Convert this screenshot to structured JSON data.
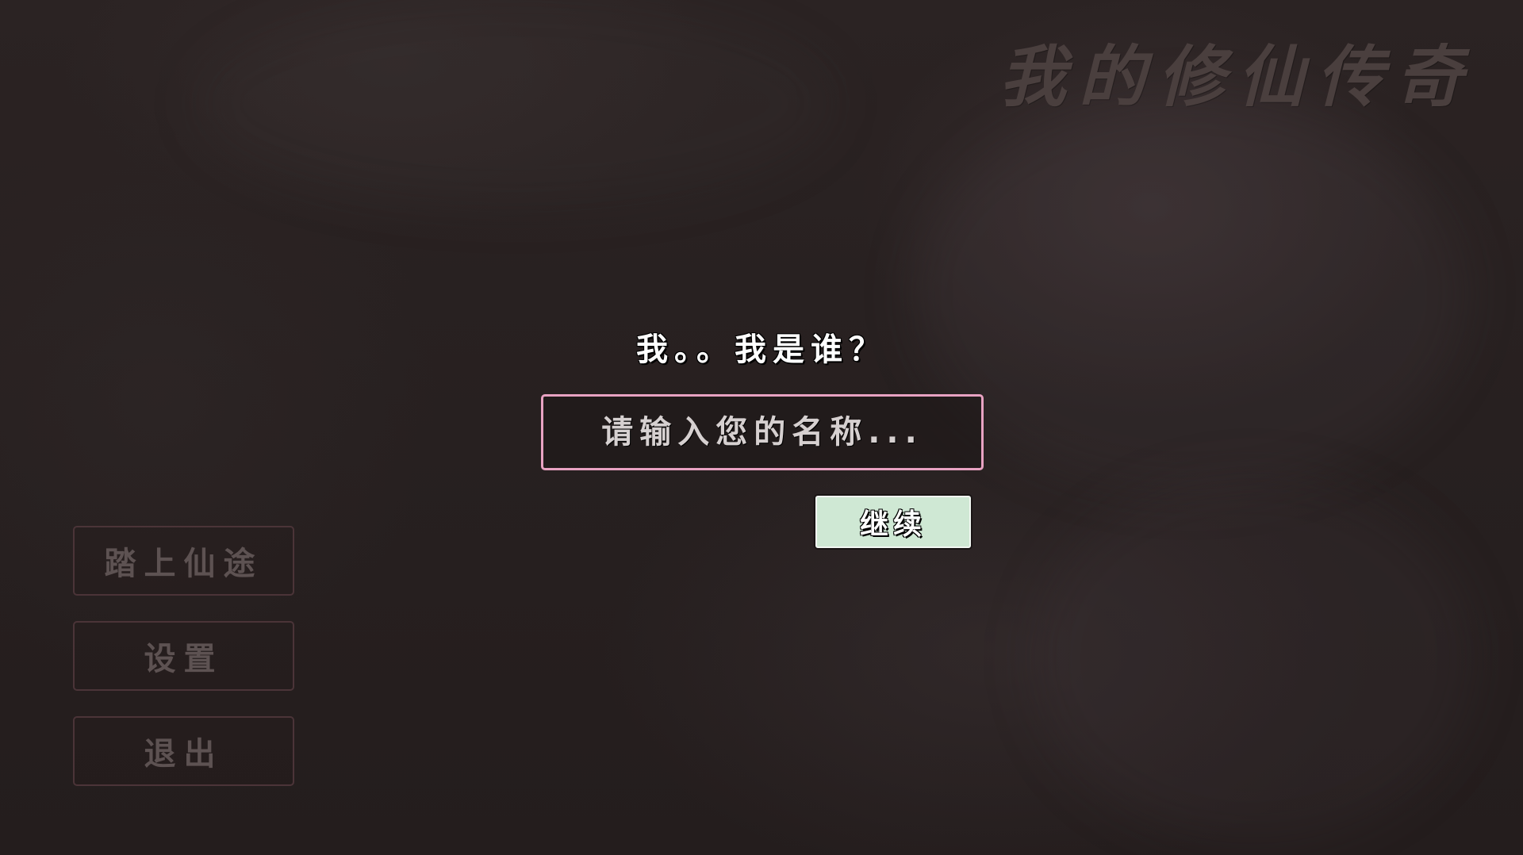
{
  "game": {
    "title": "我的修仙传奇"
  },
  "dialog": {
    "question": "我。。我是谁？",
    "name_input": {
      "value": "",
      "placeholder": "请输入您的名称..."
    },
    "continue_label": "继续"
  },
  "menu": {
    "items": [
      {
        "label": "踏上仙途"
      },
      {
        "label": "设置"
      },
      {
        "label": "退出"
      }
    ]
  },
  "colors": {
    "background": "#272020",
    "input_border": "#e8a2c2",
    "continue_button": "#cfe8d4",
    "menu_border": "#4b3438",
    "title_text": "#4a3f3e"
  }
}
